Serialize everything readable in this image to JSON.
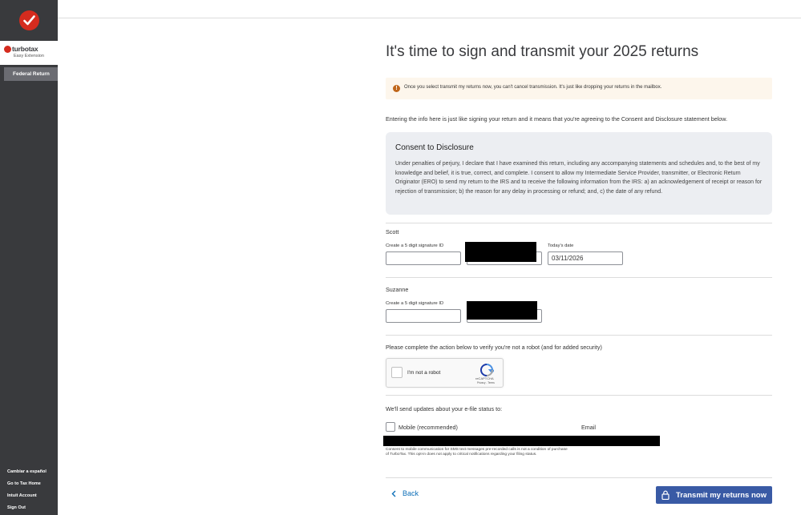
{
  "sidebar": {
    "brand_name": "turbotax",
    "brand_sub": "Easy Extension",
    "nav_federal": "Federal Return",
    "bottom_links": [
      "Cambiar a español",
      "Go to Tax Home",
      "Intuit Account",
      "Sign Out"
    ]
  },
  "page": {
    "title": "It's time to sign and transmit your 2025 returns",
    "warning": "Once you select transmit my returns now, you can't cancel transmission. It's just like dropping your returns in the mailbox.",
    "intro": "Entering the info here is just like signing your return and it means that you're agreeing to the Consent and Disclosure statement below.",
    "consent_title": "Consent to Disclosure",
    "consent_body": "Under penalties of perjury, I declare that I have examined this return, including any accompanying statements and schedules and, to the best of my knowledge and belief, it is true, correct, and complete. I consent to allow my Intermediate Service Provider, transmitter, or Electronic Return Originator (ERO) to send my return to the IRS and to receive the following information from the IRS: a) an acknowledgement of receipt or reason for rejection of transmission; b) the reason for any delay in processing or refund; and, c) the date of any refund."
  },
  "signers": [
    {
      "name": "Scott",
      "sig_label": "Create a 5 digit signature ID",
      "date_label": "Today's date",
      "date_value": "03/11/2026"
    },
    {
      "name": "Suzanne",
      "sig_label": "Create a 5 digit signature ID"
    }
  ],
  "verify": {
    "text": "Please complete the action below to verify you're not a robot (and for added security)",
    "captcha_label": "I'm not a robot",
    "captcha_brand": "reCAPTCHA",
    "captcha_links": "Privacy - Terms"
  },
  "updates": {
    "text": "We'll send updates about your e-file status to:",
    "mobile_label": "Mobile (recommended)",
    "email_label": "Email",
    "disclaimer": "Consent to mobile communication for SMS text messages pre-recorded calls is not a condition of purchase of TurboTax. This opt-in does not apply to critical notifications regarding your filing status."
  },
  "footer": {
    "back": "Back",
    "transmit": "Transmit my returns now"
  },
  "colors": {
    "sidebar": "#393a3d",
    "accent": "#395aa5",
    "brand_red": "#d52b1e",
    "link": "#0d6fb8"
  }
}
